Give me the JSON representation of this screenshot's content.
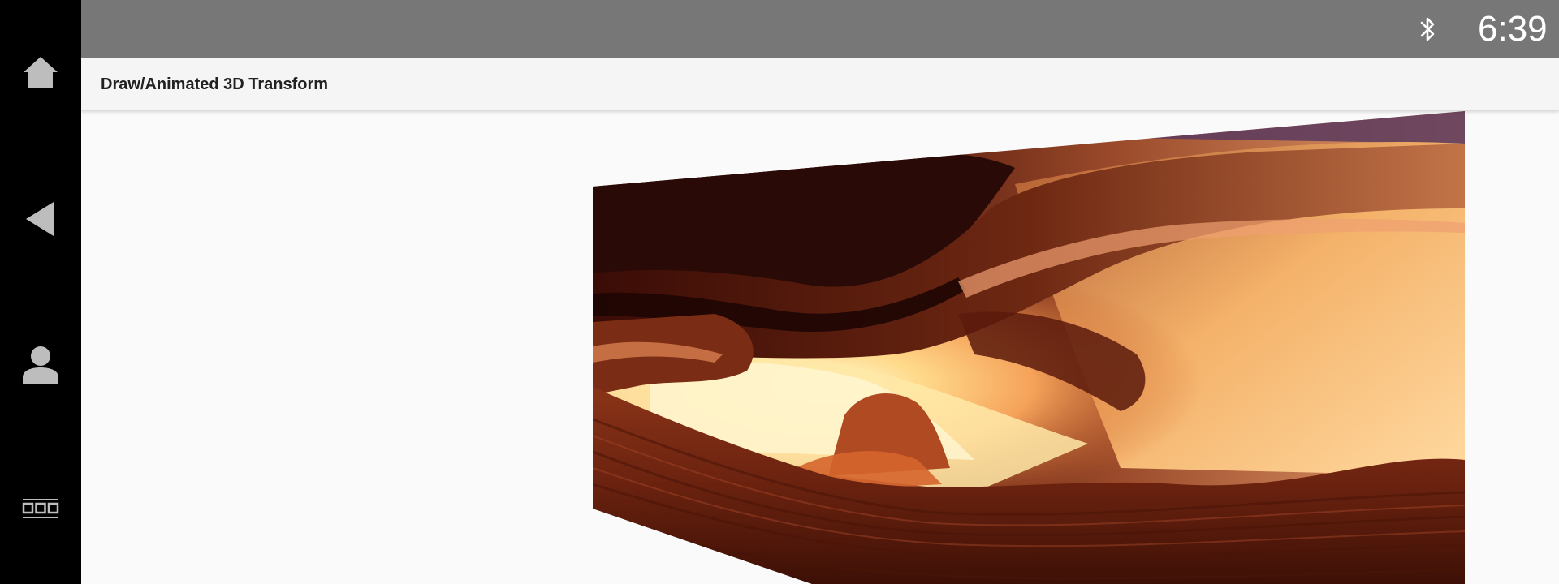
{
  "status_bar": {
    "time": "6:39 PM",
    "icons": [
      "bluetooth-icon"
    ]
  },
  "nav_rail": {
    "items": [
      {
        "name": "home-button",
        "icon": "home-icon"
      },
      {
        "name": "back-button",
        "icon": "back-triangle-icon"
      },
      {
        "name": "user-button",
        "icon": "person-icon"
      },
      {
        "name": "app-grid-button",
        "icon": "apps-grid-icon"
      }
    ]
  },
  "app_bar": {
    "title": "Draw/Animated 3D Transform"
  },
  "colors": {
    "status_bar_bg": "#777777",
    "rail_bg": "#000000",
    "app_bar_bg": "#f5f5f5",
    "content_bg": "#fafafa",
    "canyon_dark": "#2a0a06",
    "canyon_mid": "#8a3418",
    "canyon_light": "#f4b26a",
    "canyon_glow": "#fff2bd"
  }
}
